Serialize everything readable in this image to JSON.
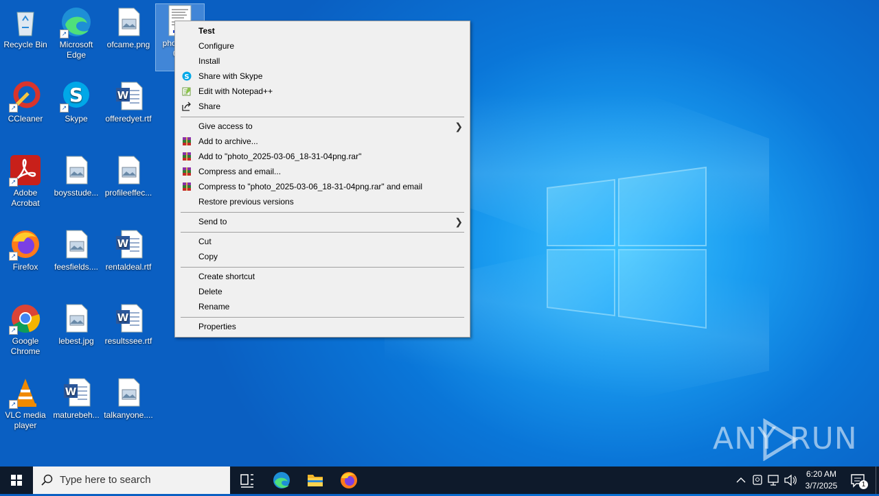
{
  "desktop": {
    "icons": [
      {
        "label": "Recycle Bin",
        "icon": "recycle-bin-icon"
      },
      {
        "label": "Microsoft Edge",
        "icon": "edge-icon"
      },
      {
        "label": "ofcame.png",
        "icon": "image-file-icon"
      },
      {
        "label": "phot 03-0 04p",
        "icon": "image-file-icon"
      },
      {
        "label": "CCleaner",
        "icon": "ccleaner-icon"
      },
      {
        "label": "Skype",
        "icon": "skype-icon"
      },
      {
        "label": "offeredyet.rtf",
        "icon": "word-file-icon"
      },
      {
        "label": "Adobe Acrobat",
        "icon": "acrobat-icon"
      },
      {
        "label": "boysstude...",
        "icon": "image-file-icon"
      },
      {
        "label": "profileeffec...",
        "icon": "image-file-icon"
      },
      {
        "label": "Firefox",
        "icon": "firefox-icon"
      },
      {
        "label": "feesfields....",
        "icon": "image-file-icon"
      },
      {
        "label": "rentaldeal.rtf",
        "icon": "word-file-icon"
      },
      {
        "label": "Google Chrome",
        "icon": "chrome-icon"
      },
      {
        "label": "lebest.jpg",
        "icon": "image-file-icon"
      },
      {
        "label": "resultssee.rtf",
        "icon": "word-file-icon"
      },
      {
        "label": "VLC media player",
        "icon": "vlc-icon"
      },
      {
        "label": "maturebeh...",
        "icon": "word-file-icon"
      },
      {
        "label": "talkanyone....",
        "icon": "image-file-icon"
      }
    ]
  },
  "context_menu": {
    "items": [
      {
        "label": "Test",
        "bold": true
      },
      {
        "label": "Configure"
      },
      {
        "label": "Install"
      },
      {
        "label": "Share with Skype",
        "icon": "skype-icon"
      },
      {
        "label": "Edit with Notepad++",
        "icon": "notepadpp-icon"
      },
      {
        "label": "Share",
        "icon": "share-icon"
      },
      {
        "label": "Give access to",
        "submenu": true
      },
      {
        "label": "Add to archive...",
        "icon": "winrar-icon"
      },
      {
        "label": "Add to \"photo_2025-03-06_18-31-04png.rar\"",
        "icon": "winrar-icon"
      },
      {
        "label": "Compress and email...",
        "icon": "winrar-icon"
      },
      {
        "label": "Compress to \"photo_2025-03-06_18-31-04png.rar\" and email",
        "icon": "winrar-icon"
      },
      {
        "label": "Restore previous versions"
      },
      {
        "label": "Send to",
        "submenu": true
      },
      {
        "label": "Cut"
      },
      {
        "label": "Copy"
      },
      {
        "label": "Create shortcut"
      },
      {
        "label": "Delete"
      },
      {
        "label": "Rename"
      },
      {
        "label": "Properties"
      }
    ]
  },
  "taskbar": {
    "search_placeholder": "Type here to search",
    "time": "6:20 AM",
    "date": "3/7/2025",
    "notification_count": "1"
  },
  "watermark": {
    "text_left": "ANY",
    "text_right": "RUN"
  },
  "colors": {
    "desktop_blue": "#0a76d8",
    "taskbar": "#0e1a2b",
    "menu_bg": "#f0f0f0"
  }
}
